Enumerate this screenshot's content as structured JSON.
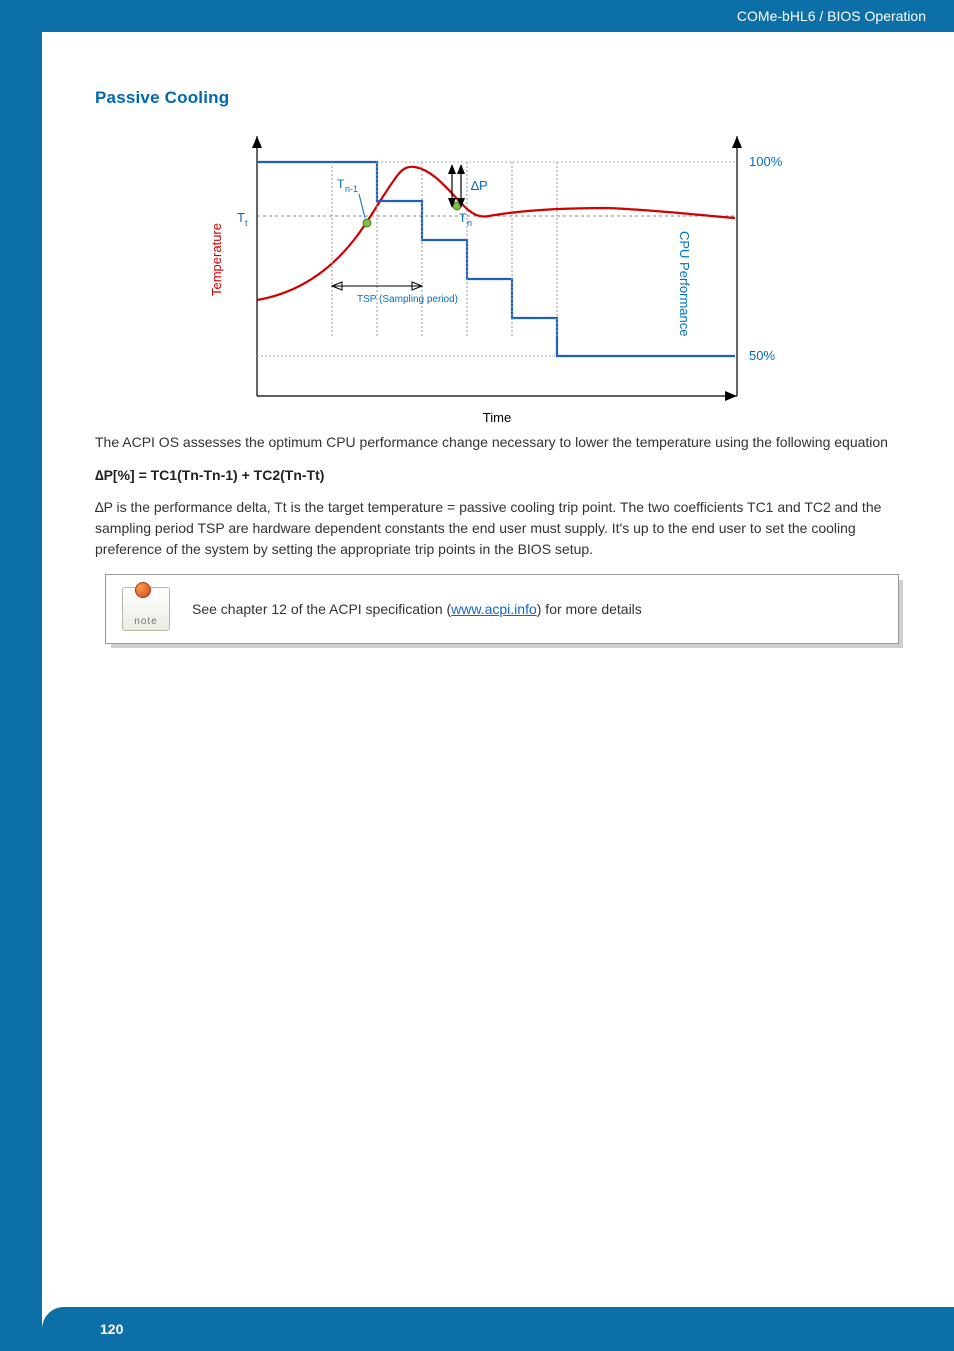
{
  "header": {
    "breadcrumb": "COMe-bHL6 / BIOS Operation"
  },
  "footer": {
    "page_number": "120"
  },
  "section": {
    "heading": "Passive Cooling"
  },
  "paragraphs": {
    "p1": "The ACPI OS assesses the optimum CPU performance change necessary to lower the temperature using the following equation",
    "formula": "∆P[%] = TC1(Tn-Tn-1) + TC2(Tn-Tt)",
    "p2": "∆P is the performance delta, Tt is the target temperature = passive cooling trip point. The two coefficients TC1 and TC2 and the sampling period TSP are hardware dependent constants the end user must supply. It's up to the end user to set the cooling preference of the system by setting the appropriate trip points in the BIOS setup."
  },
  "note": {
    "icon_label": "note",
    "prefix": "See chapter 12 of the ACPI specification (",
    "link_text": "www.acpi.info",
    "suffix": ") for more details"
  },
  "chart_data": {
    "type": "line",
    "title": "",
    "xlabel": "Time",
    "ylabel_left": "Temperature",
    "ylabel_right": "CPU Performance",
    "annotations": {
      "Tt": "T",
      "Tt_sub": "t",
      "Tn": "T",
      "Tn_sub": "n",
      "Tn1": "T",
      "Tn1_sub": "n-1",
      "deltaP": "∆P",
      "tsp": "TSP (Sampling period)",
      "perf_100": "100%",
      "perf_50": "50%"
    },
    "performance_levels": [
      100,
      100,
      100,
      100,
      87.5,
      75,
      62.5,
      50,
      50,
      50,
      50
    ],
    "temperature_profile": "rises from below Tt to above trip point Tt, peaks, then falls back toward Tt as performance throttles in steps from 100% to 50%"
  }
}
